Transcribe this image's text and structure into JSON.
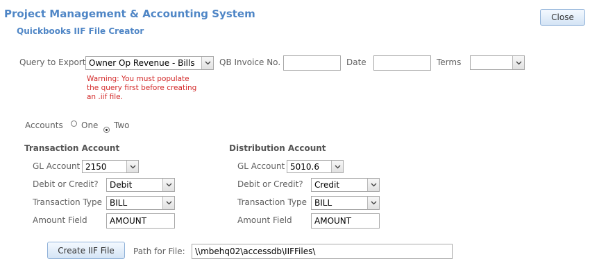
{
  "header": {
    "title": "Project Management & Accounting System",
    "subtitle": "Quickbooks IIF File Creator",
    "close_label": "Close"
  },
  "query": {
    "label": "Query to Export",
    "value": "Owner Op Revenue - Bills",
    "warning": [
      "Warning: You must populate",
      "the query first before creating",
      "an .iif file."
    ]
  },
  "invoice": {
    "label": "QB Invoice No.",
    "value": ""
  },
  "date": {
    "label": "Date",
    "value": ""
  },
  "terms": {
    "label": "Terms",
    "value": ""
  },
  "accounts": {
    "label": "Accounts",
    "options": [
      "One",
      "Two"
    ],
    "selected": "Two"
  },
  "transaction": {
    "heading": "Transaction Account",
    "gl_label": "GL Account",
    "gl_value": "2150",
    "dc_label": "Debit or Credit?",
    "dc_value": "Debit",
    "type_label": "Transaction Type",
    "type_value": "BILL",
    "amount_label": "Amount Field",
    "amount_value": "AMOUNT"
  },
  "distribution": {
    "heading": "Distribution Account",
    "gl_label": "GL Account",
    "gl_value": "5010.6",
    "dc_label": "Debit or Credit?",
    "dc_value": "Credit",
    "type_label": "Transaction Type",
    "type_value": "BILL",
    "amount_label": "Amount Field",
    "amount_value": "AMOUNT"
  },
  "footer": {
    "create_label": "Create IIF File",
    "path_label": "Path for File:",
    "path_value": "\\\\mbehq02\\accessdb\\IIFFiles\\"
  }
}
